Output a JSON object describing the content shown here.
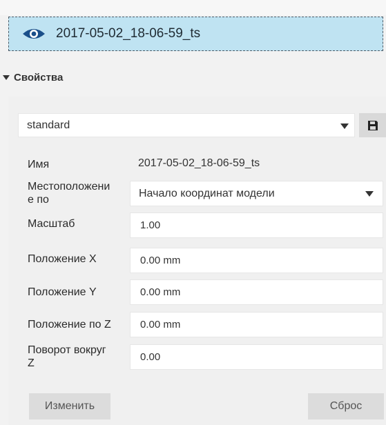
{
  "layer": {
    "name": "2017-05-02_18-06-59_ts",
    "icon": "eye-icon"
  },
  "section": {
    "title": "Свойства"
  },
  "preset": {
    "value": "standard",
    "save_icon": "save-icon"
  },
  "properties": {
    "name_label": "Имя",
    "name_value": "2017-05-02_18-06-59_ts",
    "location_label_line1": "Местоположени",
    "location_label_line2": "е по",
    "location_value": "Начало координат модели",
    "scale_label": "Масштаб",
    "scale_value": "1.00",
    "pos_x_label": "Положение X",
    "pos_x_value": "0.00 mm",
    "pos_y_label": "Положение Y",
    "pos_y_value": "0.00 mm",
    "pos_z_label": "Положение по Z",
    "pos_z_value": "0.00 mm",
    "rot_z_label_line1": "Поворот вокруг",
    "rot_z_label_line2": "Z",
    "rot_z_value": "0.00"
  },
  "actions": {
    "modify_label": "Изменить",
    "reset_label": "Сброс"
  },
  "colors": {
    "selected_row_bg": "#bfe3f2",
    "eye_icon": "#1a4f8a",
    "panel_bg": "#f0f0f0"
  }
}
